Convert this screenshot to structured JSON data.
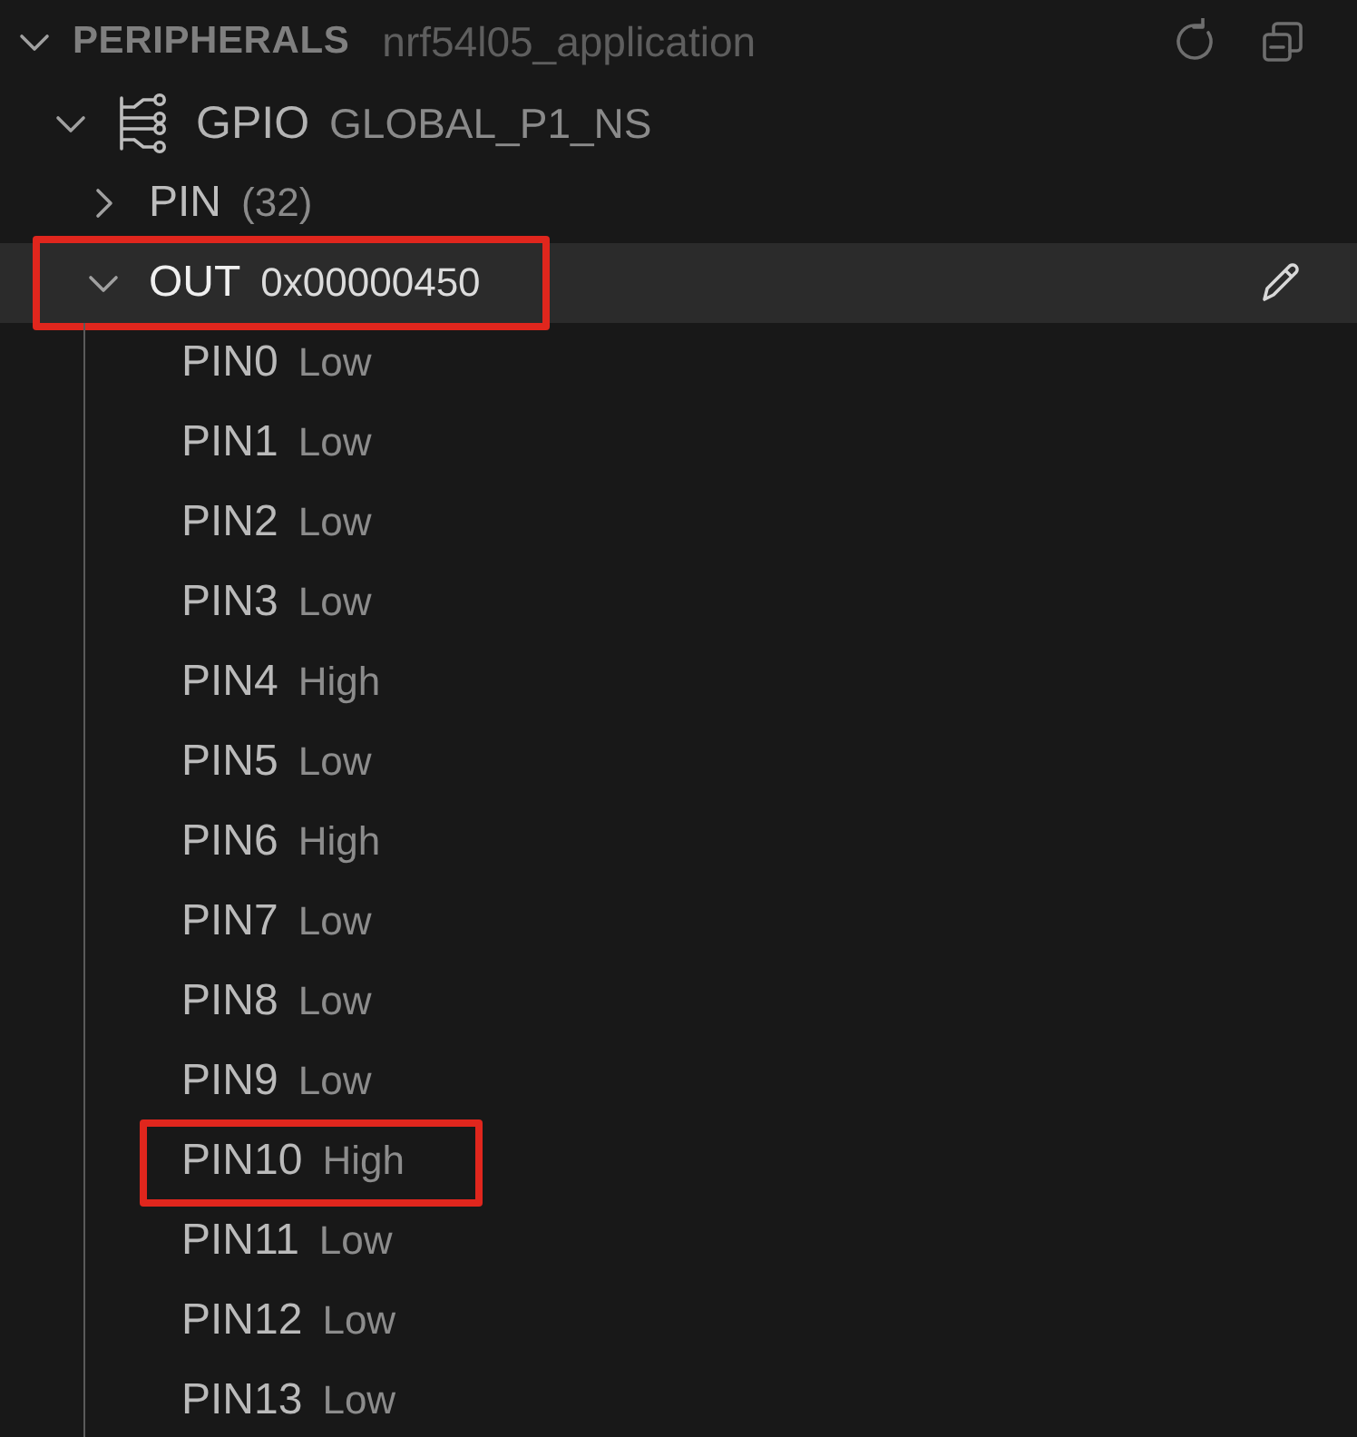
{
  "section": {
    "title": "PERIPHERALS",
    "subtitle": "nrf54l05_application",
    "expanded": true
  },
  "tree": [
    {
      "name": "GPIO",
      "value": "GLOBAL_P1_NS",
      "kind": "peripheral",
      "expanded": true,
      "selected": false,
      "annotated": false,
      "children": [
        {
          "name": "PIN",
          "value": "(32)",
          "kind": "group",
          "expanded": false,
          "selected": false,
          "annotated": false
        },
        {
          "name": "OUT",
          "value": "0x00000450",
          "kind": "group",
          "expanded": true,
          "selected": true,
          "annotated": true,
          "children": [
            {
              "name": "PIN0",
              "value": "Low",
              "kind": "field",
              "selected": false,
              "annotated": false
            },
            {
              "name": "PIN1",
              "value": "Low",
              "kind": "field",
              "selected": false,
              "annotated": false
            },
            {
              "name": "PIN2",
              "value": "Low",
              "kind": "field",
              "selected": false,
              "annotated": false
            },
            {
              "name": "PIN3",
              "value": "Low",
              "kind": "field",
              "selected": false,
              "annotated": false
            },
            {
              "name": "PIN4",
              "value": "High",
              "kind": "field",
              "selected": false,
              "annotated": false
            },
            {
              "name": "PIN5",
              "value": "Low",
              "kind": "field",
              "selected": false,
              "annotated": false
            },
            {
              "name": "PIN6",
              "value": "High",
              "kind": "field",
              "selected": false,
              "annotated": false
            },
            {
              "name": "PIN7",
              "value": "Low",
              "kind": "field",
              "selected": false,
              "annotated": false
            },
            {
              "name": "PIN8",
              "value": "Low",
              "kind": "field",
              "selected": false,
              "annotated": false
            },
            {
              "name": "PIN9",
              "value": "Low",
              "kind": "field",
              "selected": false,
              "annotated": false
            },
            {
              "name": "PIN10",
              "value": "High",
              "kind": "field",
              "selected": false,
              "annotated": true
            },
            {
              "name": "PIN11",
              "value": "Low",
              "kind": "field",
              "selected": false,
              "annotated": false
            },
            {
              "name": "PIN12",
              "value": "Low",
              "kind": "field",
              "selected": false,
              "annotated": false
            },
            {
              "name": "PIN13",
              "value": "Low",
              "kind": "field",
              "selected": false,
              "annotated": false
            }
          ]
        }
      ]
    }
  ]
}
